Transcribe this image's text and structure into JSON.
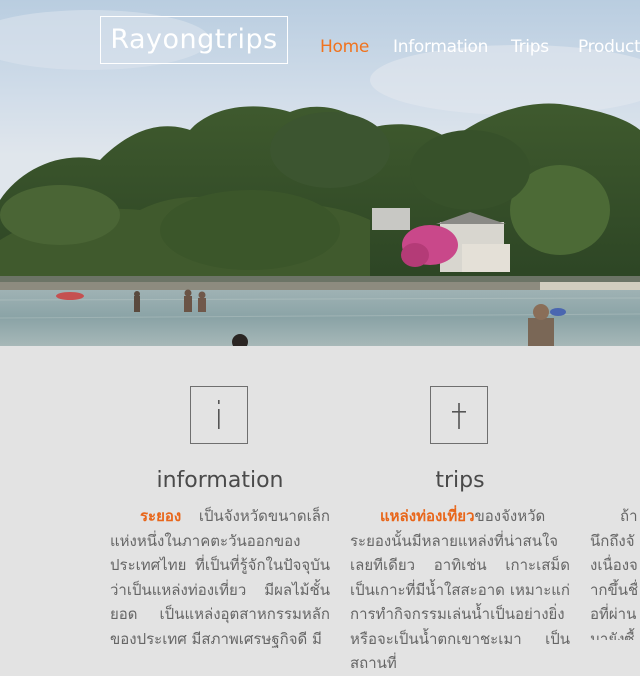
{
  "site": {
    "logo": "Rayongtrips"
  },
  "nav": [
    {
      "label": "Home",
      "active": true
    },
    {
      "label": "Information",
      "active": false
    },
    {
      "label": "Trips",
      "active": false
    },
    {
      "label": "Product",
      "active": false
    }
  ],
  "features": [
    {
      "icon_glyph": "i",
      "icon_name": "info-icon",
      "title": "information",
      "highlight": "ระยอง",
      "text": " เป็นจังหวัดขนาดเล็กแห่งหนึ่งในภาคตะวันออกของประเทศไทย ที่เป็นที่รู้จักในปัจจุบันว่าเป็นแหล่งท่องเที่ยว มีผลไม้ชั้นยอด เป็นแหล่งอุตสาหกรรมหลักของประเทศ มีสภาพเศรษฐกิจดี มี"
    },
    {
      "icon_glyph": "†",
      "icon_name": "dagger-icon",
      "title": "trips",
      "highlight": "แหล่งท่องเที่ยว",
      "text": "ของจังหวัดระยองนั้นมีหลายแหล่งที่น่าสนใจเลยทีเดียว อาทิเช่น เกาะเสม็ด เป็นเกาะที่มีน้ำใสสะอาด เหมาะแก่การทำกิจกรรมเล่นน้ำเป็นอย่างยิ่ง หรือจะเป็นน้ำตกเขาชะเมา เป็นสถานที่"
    },
    {
      "title": "",
      "highlight": "",
      "text": "ถ้านึกถึงจังเนื่องจากขึ้นชื่อที่ผ่านมายังซื้อที่"
    }
  ],
  "colors": {
    "accent": "#f0731e",
    "highlight": "#e8661a",
    "background": "#e3e3e3"
  }
}
